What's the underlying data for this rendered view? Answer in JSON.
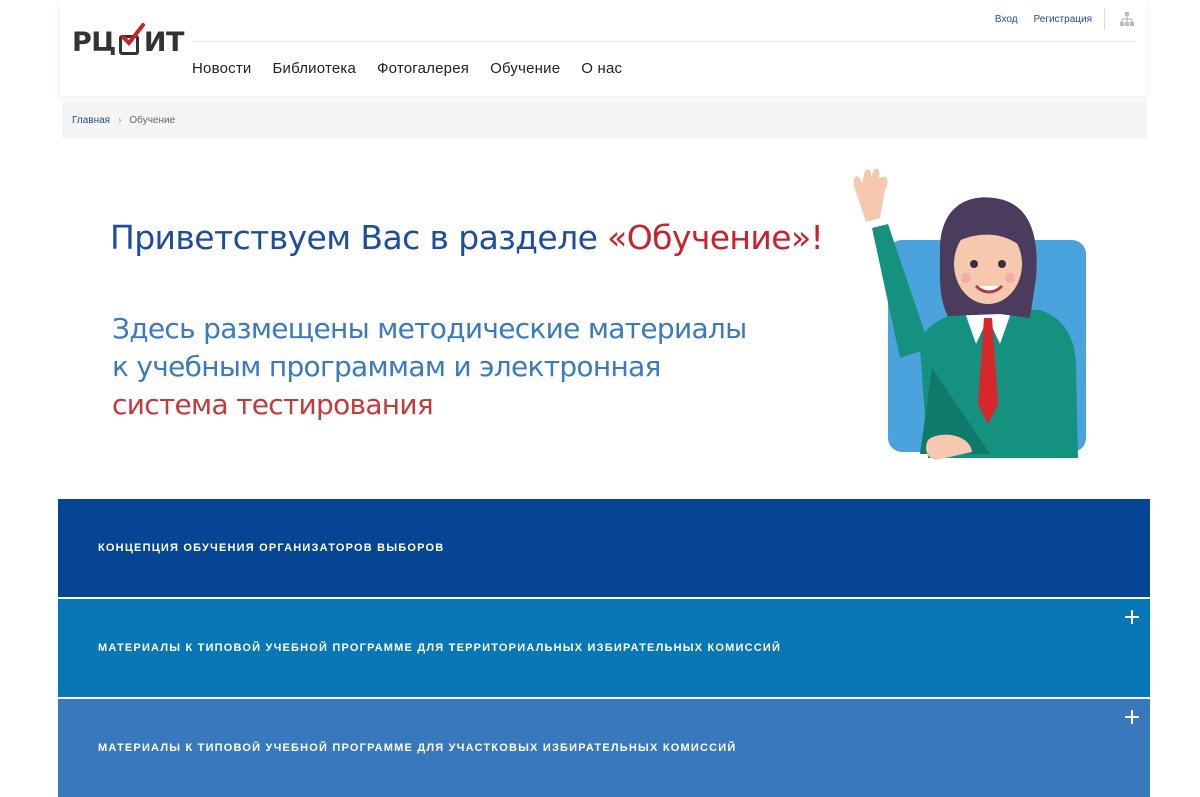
{
  "header": {
    "logo": {
      "left": "РЦ",
      "right": "ИТ"
    },
    "top_links": [
      "Вход",
      "Регистрация"
    ],
    "nav": [
      "Новости",
      "Библиотека",
      "Фотогалерея",
      "Обучение",
      "О нас"
    ]
  },
  "breadcrumb": {
    "home": "Главная",
    "current": "Обучение"
  },
  "banner": {
    "title_main": "Приветствуем Вас в разделе ",
    "title_accent": "«Обучение»!",
    "line1": "Здесь размещены методические материалы",
    "line2": "к учебным программам и электронная",
    "line3": "система тестирования"
  },
  "accordion": [
    {
      "label": "КОНЦЕПЦИЯ ОБУЧЕНИЯ ОРГАНИЗАТОРОВ ВЫБОРОВ",
      "color": "#064494",
      "expandable": false
    },
    {
      "label": "МАТЕРИАЛЫ К ТИПОВОЙ УЧЕБНОЙ ПРОГРАММЕ ДЛЯ ТЕРРИТОРИАЛЬНЫХ ИЗБИРАТЕЛЬНЫХ КОМИССИЙ",
      "color": "#0877b7",
      "expandable": true
    },
    {
      "label": "МАТЕРИАЛЫ К ТИПОВОЙ УЧЕБНОЙ ПРОГРАММЕ ДЛЯ УЧАСТКОВЫХ ИЗБИРАТЕЛЬНЫХ КОМИССИЙ",
      "color": "#3878bd",
      "expandable": true
    }
  ],
  "colors": {
    "accent_red": "#c8232c",
    "title_blue": "#1d4d9b",
    "link_blue": "#1c4e8c"
  }
}
